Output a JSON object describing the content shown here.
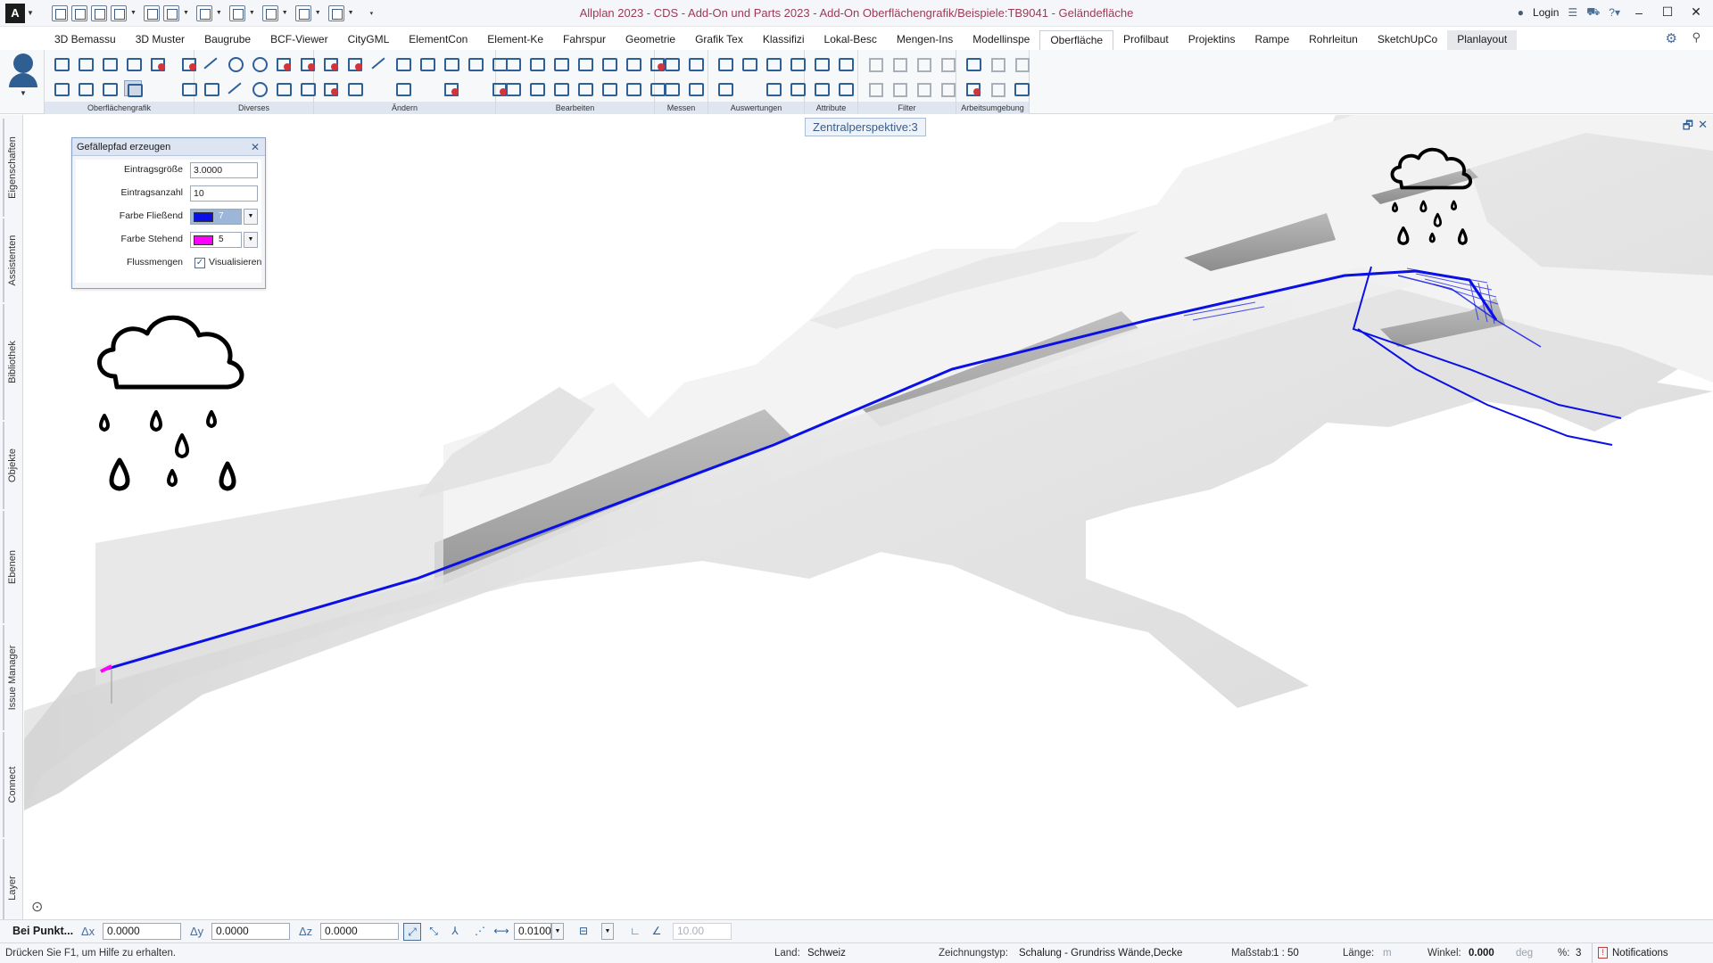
{
  "window": {
    "title": "Allplan 2023 - CDS - Add-On und Parts 2023 - Add-On Oberflächengrafik/Beispiele:TB9041 - Geländefläche",
    "logo": "A",
    "login": "Login"
  },
  "ribbon": {
    "tabs": [
      "3D Bemassu",
      "3D Muster",
      "Baugrube",
      "BCF-Viewer",
      "CityGML",
      "ElementCon",
      "Element-Ke",
      "Fahrspur",
      "Geometrie",
      "Grafik Tex",
      "Klassifizi",
      "Lokal-Besc",
      "Mengen-Ins",
      "Modellinspe",
      "Oberfläche",
      "Profilbaut",
      "Projektins",
      "Rampe",
      "Rohrleitun",
      "SketchUpCo",
      "Planlayout"
    ],
    "active_tab": "Oberfläche",
    "groups": [
      "Oberflächengrafik",
      "Diverses",
      "Ändern",
      "Bearbeiten",
      "Messen",
      "Auswertungen",
      "Attribute",
      "Filter",
      "Arbeitsumgebung"
    ]
  },
  "viewport": {
    "tooltip": "Zentralperspektive:3"
  },
  "sidebar": {
    "tabs": [
      "Eigenschaften",
      "Assistenten",
      "Bibliothek",
      "Objekte",
      "Ebenen",
      "Issue Manager",
      "Connect",
      "Layer"
    ]
  },
  "dialog": {
    "title": "Gefällepfad erzeugen",
    "rows": {
      "eintragsgroesse": {
        "label": "Eintragsgröße",
        "value": "3.0000"
      },
      "eintragsanzahl": {
        "label": "Eintragsanzahl",
        "value": "10"
      },
      "farbe_fliessend": {
        "label": "Farbe Fließend",
        "number": "7",
        "color": "#0a10e6"
      },
      "farbe_stehend": {
        "label": "Farbe Stehend",
        "number": "5",
        "color": "#ff00ff"
      },
      "flussmengen": {
        "label": "Flussmengen",
        "checkbox_label": "Visualisieren",
        "checked": true
      }
    }
  },
  "coords": {
    "mode": "Bei Punkt...",
    "dx_label": "Δx",
    "dx": "0.0000",
    "dy_label": "Δy",
    "dy": "0.0000",
    "dz_label": "Δz",
    "dz": "0.0000",
    "step": "0.0100",
    "angle": "10.00"
  },
  "status": {
    "hint": "Drücken Sie F1, um Hilfe zu erhalten.",
    "land_label": "Land:",
    "land": "Schweiz",
    "zeichnungstyp_label": "Zeichnungstyp:",
    "zeichnungstyp": "Schalung - Grundriss Wände,Decke",
    "massstab_label": "Maßstab:",
    "massstab": "1 : 50",
    "laenge_label": "Länge:",
    "laenge_unit": "m",
    "winkel_label": "Winkel:",
    "winkel": "0.000",
    "winkel_unit": "deg",
    "prozent_label": "%:",
    "prozent": "3",
    "notifications": "Notifications"
  },
  "colors": {
    "flow_path": "#0a10e6",
    "flow_start": "#ff00ff",
    "terrain": "#e9e9e9",
    "accent": "#2e5f96"
  },
  "icons": {
    "rain_cloud_left": "rain-cloud-icon",
    "rain_cloud_right": "rain-cloud-icon"
  }
}
